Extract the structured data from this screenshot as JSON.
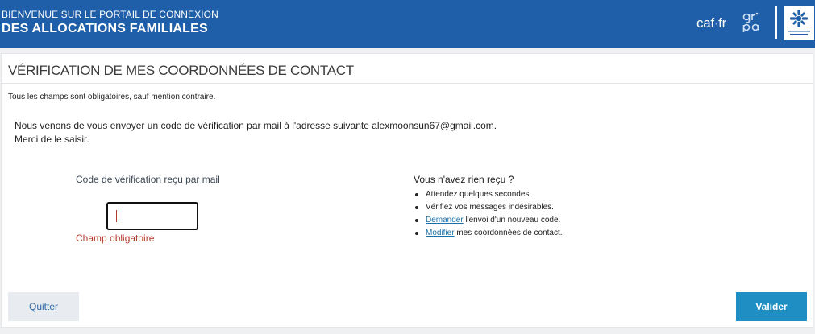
{
  "header": {
    "line1": "BIENVENUE SUR LE PORTAIL DE CONNEXION",
    "line2": "DES ALLOCATIONS FAMILIALES",
    "caf_logo_text": "caf·fr",
    "caf_logo_prefix": "caf",
    "caf_logo_dot": "·",
    "caf_logo_suffix": "fr",
    "gripa_logo_letters": "gripa",
    "emblem_icon": "caf-emblem-icon"
  },
  "card": {
    "title": "VÉRIFICATION DE MES COORDONNÉES DE CONTACT",
    "mandatory_note": "Tous les champs sont obligatoires, sauf mention contraire.",
    "message_line1": "Nous venons de vous envoyer un code de vérification par mail à l'adresse suivante alexmoonsun67@gmail.com.",
    "message_line2": "Merci de le saisir."
  },
  "form": {
    "code_label": "Code de vérification reçu par mail",
    "code_value": "",
    "error": "Champ obligatoire"
  },
  "help": {
    "title": "Vous n'avez rien reçu ?",
    "item1": "Attendez quelques secondes.",
    "item2": "Vérifiez vos messages indésirables.",
    "item3_link": "Demander",
    "item3_rest": " l'envoi d'un nouveau code.",
    "item4_link": "Modifier",
    "item4_rest": " mes coordonnées de contact."
  },
  "buttons": {
    "quit": "Quitter",
    "validate": "Valider"
  },
  "colors": {
    "header_bg": "#1f5ea8",
    "primary_button": "#1f8ec3",
    "error": "#b03a2e",
    "link": "#1a6fa8"
  }
}
